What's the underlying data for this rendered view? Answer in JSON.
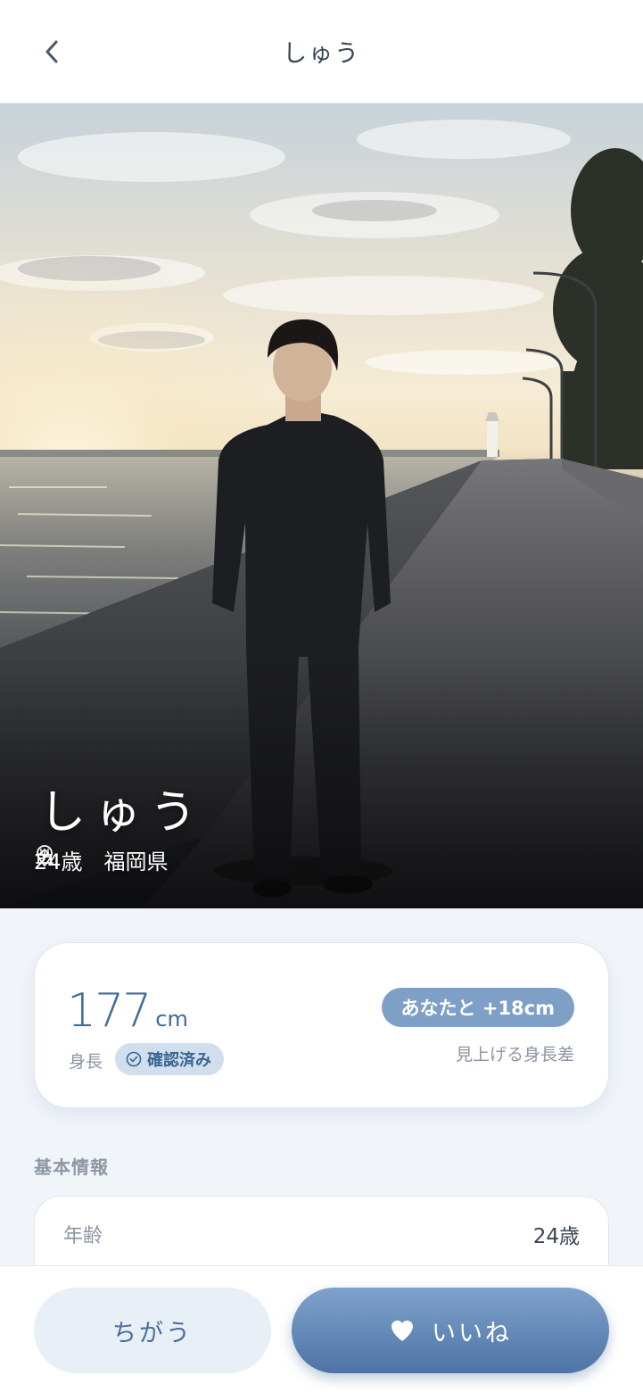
{
  "header": {
    "title": "しゅう",
    "back_icon": "chevron-left-icon"
  },
  "profile": {
    "name": "しゅう",
    "age": "24歳",
    "location": "福岡県",
    "age_icon": "cake-icon",
    "location_icon": "map-pin-icon"
  },
  "height_card": {
    "value": "177",
    "unit": "cm",
    "label": "身長",
    "verified": "確認済み",
    "difference": "あなたと +18cm",
    "difference_label": "見上げる身長差"
  },
  "basic_info": {
    "title": "基本情報",
    "rows": [
      {
        "key": "年齢",
        "value": "24歳"
      }
    ]
  },
  "actions": {
    "nope": "ちがう",
    "like": "いいね",
    "like_icon": "heart-icon"
  },
  "colors": {
    "accent": "#4d74a6",
    "accent_light": "#7e9fc6",
    "badge_bg": "#d0deed",
    "background": "#f1f5fa"
  }
}
